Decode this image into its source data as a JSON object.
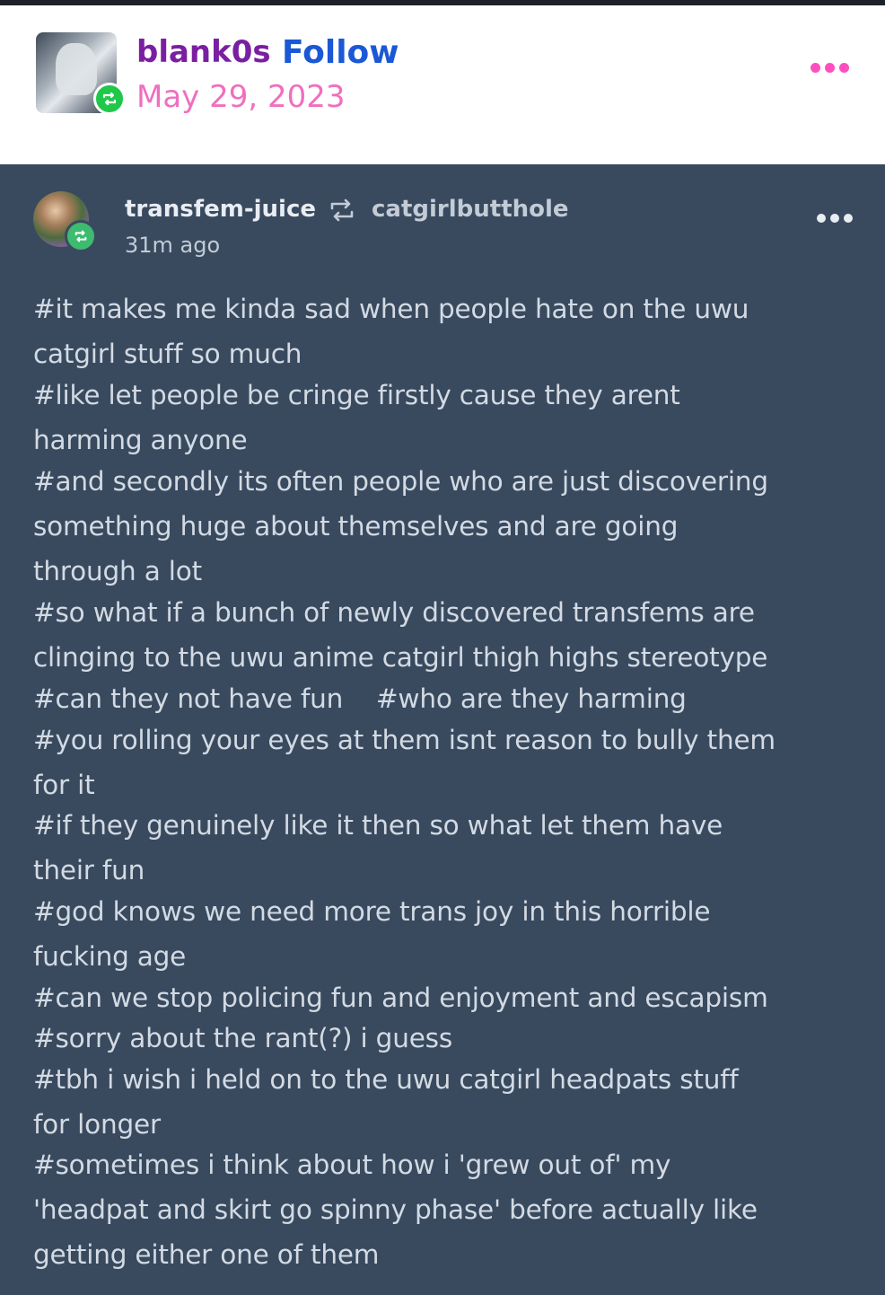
{
  "header": {
    "username": "blank0s",
    "follow_label": "Follow",
    "date": "May 29, 2023",
    "more_icon": "more-dots-icon",
    "reblog_badge_icon": "reblog-icon"
  },
  "post": {
    "author": "transfem-juice",
    "reblogged_from": "catgirlbutthole",
    "time_ago": "31m ago",
    "tag_lines": [
      "#it makes me kinda sad when people hate on the uwu",
      "catgirl stuff so much",
      "#like let people be cringe firstly cause they arent",
      "harming anyone",
      "#and secondly its often people who are just discovering",
      "something huge about themselves and are going",
      "through a lot",
      "#so what if a bunch of newly discovered transfems are",
      "clinging to the uwu anime catgirl thigh highs stereotype",
      "#can they not have fun    #who are they harming",
      "#you rolling your eyes at them isnt reason to bully them",
      "for it",
      "#if they genuinely like it then so what let them have",
      "their fun",
      "#god knows we need more trans joy in this horrible",
      "fucking age",
      "#can we stop policing fun and enjoyment and escapism",
      "#sorry about the rant(?) i guess",
      "#tbh i wish i held on to the uwu catgirl headpats stuff",
      "for longer",
      "#sometimes i think about how i 'grew out of' my",
      "'headpat and skirt go spinny phase' before actually like",
      "getting either one of them"
    ]
  },
  "colors": {
    "username": "#7a1fa2",
    "follow": "#1a58d6",
    "date": "#f06fbe",
    "post_bg": "#394a5f"
  }
}
